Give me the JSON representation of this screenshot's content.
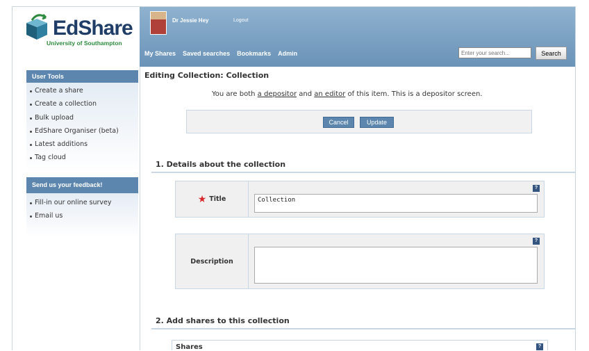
{
  "brand": {
    "name": "EdShare",
    "subtitle": "University of Southampton"
  },
  "header": {
    "user_name": "Dr Jessie Hey",
    "logout": "Logout",
    "nav": [
      "My Shares",
      "Saved searches",
      "Bookmarks",
      "Admin"
    ],
    "search_placeholder": "Enter your search...",
    "search_button": "Search"
  },
  "sidebar": {
    "tools_title": "User Tools",
    "tools": [
      "Create a share",
      "Create a collection",
      "Bulk upload",
      "EdShare Organiser (beta)",
      "Latest additions",
      "Tag cloud"
    ],
    "feedback_title": "Send us your feedback!",
    "feedback": [
      "Fill-in our online survey",
      "Email us"
    ]
  },
  "main": {
    "page_title": "Editing Collection: Collection",
    "intro_prefix": "You are both ",
    "intro_depositor": "a depositor",
    "intro_and": " and ",
    "intro_editor": "an editor",
    "intro_suffix": " of this item. This is a depositor screen.",
    "cancel": "Cancel",
    "update": "Update",
    "section1": "1. Details about the collection",
    "title_label": "Title",
    "title_value": "Collection",
    "description_label": "Description",
    "description_value": "",
    "section2": "2. Add shares to this collection",
    "shares_label": "Shares",
    "help_glyph": "?"
  },
  "colors": {
    "header_blue": "#6a93b8",
    "accent_blue": "#5d86ae",
    "required_red": "#d8262a"
  }
}
